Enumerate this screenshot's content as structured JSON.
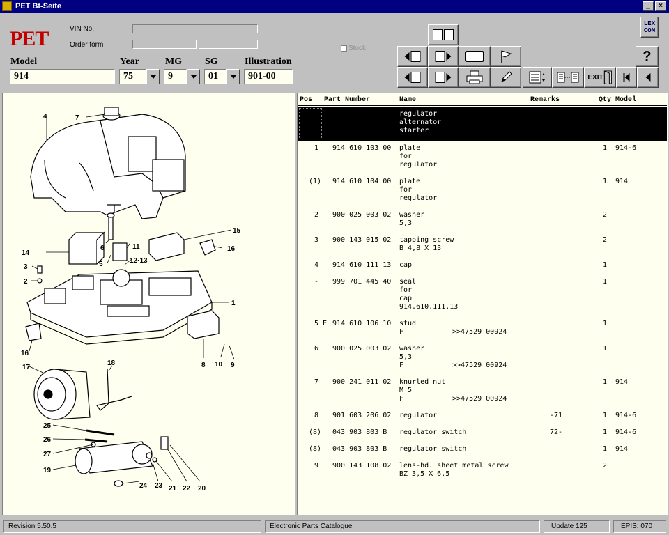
{
  "window": {
    "title": "PET Bt-Seite",
    "minimize": "_",
    "close": "×"
  },
  "header": {
    "logo": "PET",
    "vin_label": "VIN No.",
    "order_label": "Order form",
    "stock_label": "Stock",
    "model_label": "Model",
    "model_value": "914",
    "year_label": "Year",
    "year_value": "75",
    "mg_label": "MG",
    "mg_value": "9",
    "sg_label": "SG",
    "sg_value": "01",
    "illustration_label": "Illustration",
    "illustration_value": "901-00",
    "lexcom": "LEX\nCOM",
    "help": "?",
    "exit": "EXIT"
  },
  "columns": {
    "pos": "Pos",
    "part": "Part Number",
    "name": "Name",
    "remarks": "Remarks",
    "qty": "Qty",
    "model": "Model"
  },
  "selected_group": {
    "name": "regulator\nalternator\nstarter"
  },
  "parts": [
    {
      "pos": "1",
      "e": "",
      "part": "914 610 103 00",
      "name": "plate\nfor\nregulator",
      "remarks": "",
      "extra": "",
      "qty": "1",
      "model": "914-6"
    },
    {
      "pos": "(1)",
      "e": "",
      "part": "914 610 104 00",
      "name": "plate\nfor\nregulator",
      "remarks": "",
      "extra": "",
      "qty": "1",
      "model": "914"
    },
    {
      "pos": "2",
      "e": "",
      "part": "900 025 003 02",
      "name": "washer\n5,3",
      "remarks": "",
      "extra": "",
      "qty": "2",
      "model": ""
    },
    {
      "pos": "3",
      "e": "",
      "part": "900 143 015 02",
      "name": "tapping screw\nB 4,8 X 13",
      "remarks": "",
      "extra": "",
      "qty": "2",
      "model": ""
    },
    {
      "pos": "4",
      "e": "",
      "part": "914 610 111 13",
      "name": "cap",
      "remarks": "",
      "extra": "",
      "qty": "1",
      "model": ""
    },
    {
      "pos": "-",
      "e": "",
      "part": "999 701 445 40",
      "name": "seal\nfor\ncap\n914.610.111.13",
      "remarks": "",
      "extra": "",
      "qty": "1",
      "model": ""
    },
    {
      "pos": "5",
      "e": "E",
      "part": "914 610 106 10",
      "name": "stud\nF",
      "remarks": "",
      "extra": ">>47529 00924",
      "qty": "1",
      "model": ""
    },
    {
      "pos": "6",
      "e": "",
      "part": "900 025 003 02",
      "name": "washer\n5,3\nF",
      "remarks": "",
      "extra": ">>47529 00924",
      "qty": "1",
      "model": ""
    },
    {
      "pos": "7",
      "e": "",
      "part": "900 241 011 02",
      "name": "knurled nut\nM 5\nF",
      "remarks": "",
      "extra": ">>47529 00924",
      "qty": "1",
      "model": "914"
    },
    {
      "pos": "8",
      "e": "",
      "part": "901 603 206 02",
      "name": "regulator",
      "remarks": "-71",
      "extra": "",
      "qty": "1",
      "model": "914-6"
    },
    {
      "pos": "(8)",
      "e": "",
      "part": "043 903 803 B",
      "name": "regulator switch",
      "remarks": "72-",
      "extra": "",
      "qty": "1",
      "model": "914-6"
    },
    {
      "pos": "(8)",
      "e": "",
      "part": "043 903 803 B",
      "name": "regulator switch",
      "remarks": "",
      "extra": "",
      "qty": "1",
      "model": "914"
    },
    {
      "pos": "9",
      "e": "",
      "part": "900 143 108 02",
      "name": "lens-hd. sheet metal screw\nBZ 3,5 X 6,5",
      "remarks": "",
      "extra": "",
      "qty": "2",
      "model": ""
    }
  ],
  "callouts": [
    "7",
    "4",
    "15",
    "14",
    "6",
    "11",
    "16",
    "5",
    "12·13",
    "3",
    "2",
    "1",
    "16",
    "8",
    "10",
    "9",
    "17",
    "18",
    "25",
    "26",
    "27",
    "19",
    "24",
    "23",
    "21",
    "22",
    "20"
  ],
  "status": {
    "revision": "Revision 5.50.5",
    "catalogue": "Electronic Parts Catalogue",
    "update": "Update 125",
    "epis": "EPIS: 070"
  }
}
